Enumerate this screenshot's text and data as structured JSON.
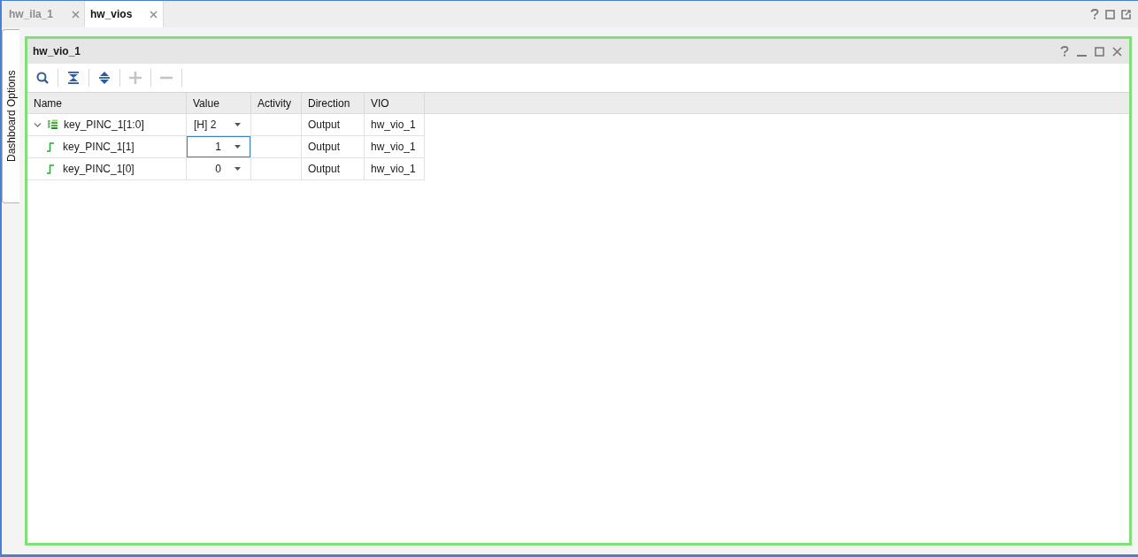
{
  "tabs": [
    {
      "label": "hw_ila_1",
      "selected": false
    },
    {
      "label": "hw_vios",
      "selected": true
    }
  ],
  "side_tab": {
    "label": "Dashboard Options"
  },
  "panel": {
    "title": "hw_vio_1",
    "toolbar": [
      {
        "kind": "search",
        "disabled": false
      },
      {
        "kind": "collapse_all",
        "disabled": false
      },
      {
        "kind": "expand_all",
        "disabled": false
      },
      {
        "kind": "add",
        "disabled": true
      },
      {
        "kind": "remove",
        "disabled": true
      }
    ],
    "table": {
      "columns": [
        "Name",
        "Value",
        "Activity",
        "Direction",
        "VIO"
      ],
      "rows": [
        {
          "kind": "bus",
          "name": "key_PINC_1[1:0]",
          "expanded": true,
          "value": "[H] 2",
          "focused": false,
          "direction": "Output",
          "vio": "hw_vio_1",
          "children": [
            {
              "kind": "bit",
              "name": "key_PINC_1[1]",
              "value": "1",
              "focused": true,
              "direction": "Output",
              "vio": "hw_vio_1"
            },
            {
              "kind": "bit",
              "name": "key_PINC_1[0]",
              "value": "0",
              "focused": false,
              "direction": "Output",
              "vio": "hw_vio_1"
            }
          ]
        }
      ]
    }
  }
}
